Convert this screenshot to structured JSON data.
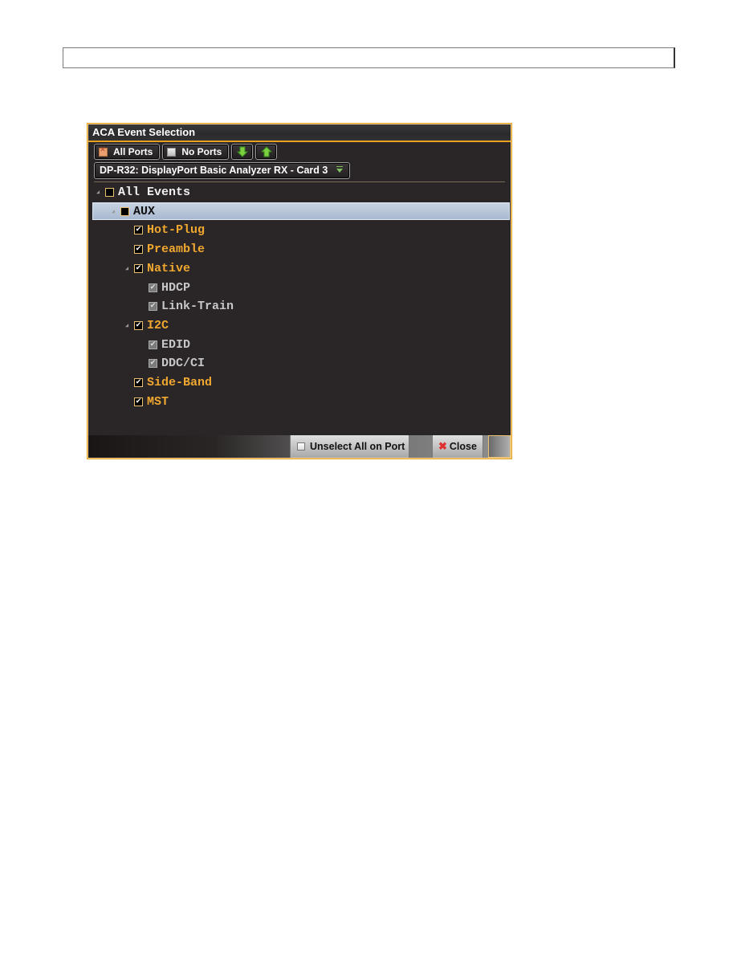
{
  "dialog": {
    "title": "ACA Event Selection",
    "toolbar": {
      "all_ports_label": "All Ports",
      "all_ports_icon": "checkbox-x-icon",
      "no_ports_label": "No Ports",
      "no_ports_icon": "checkbox-empty-icon",
      "move_down_icon": "arrow-down-icon",
      "move_up_icon": "arrow-up-icon"
    },
    "port_select": {
      "value": "DP-R32: DisplayPort Basic Analyzer RX - Card 3"
    },
    "tree": [
      {
        "label": "All Events",
        "level": 0,
        "state": "unchecked",
        "style": "white",
        "expander": true
      },
      {
        "label": "AUX",
        "level": 1,
        "state": "partial",
        "style": "black",
        "expander": true,
        "selected": true
      },
      {
        "label": "Hot-Plug",
        "level": 2,
        "state": "checked",
        "style": "orange"
      },
      {
        "label": "Preamble",
        "level": 2,
        "state": "checked",
        "style": "orange"
      },
      {
        "label": "Native",
        "level": 2,
        "state": "checked",
        "style": "orange",
        "expander": true
      },
      {
        "label": "HDCP",
        "level": 3,
        "state": "checked-disabled",
        "style": "gray"
      },
      {
        "label": "Link-Train",
        "level": 3,
        "state": "checked-disabled",
        "style": "gray"
      },
      {
        "label": "I2C",
        "level": 2,
        "state": "checked",
        "style": "orange",
        "expander": true
      },
      {
        "label": "EDID",
        "level": 3,
        "state": "checked-disabled",
        "style": "gray"
      },
      {
        "label": "DDC/CI",
        "level": 3,
        "state": "checked-disabled",
        "style": "gray"
      },
      {
        "label": "Side-Band",
        "level": 2,
        "state": "checked",
        "style": "orange"
      },
      {
        "label": "MST",
        "level": 2,
        "state": "checked",
        "style": "orange"
      }
    ],
    "footer": {
      "unselect_label": "Unselect All on Port",
      "close_label": "Close",
      "close_icon": "close-x-icon"
    }
  },
  "colors": {
    "accent": "#e8a020",
    "dialog_bg": "#2a2526",
    "checked_label": "#f0a830",
    "disabled_label": "#c8c8c8",
    "selected_row": "#b8c6da"
  }
}
